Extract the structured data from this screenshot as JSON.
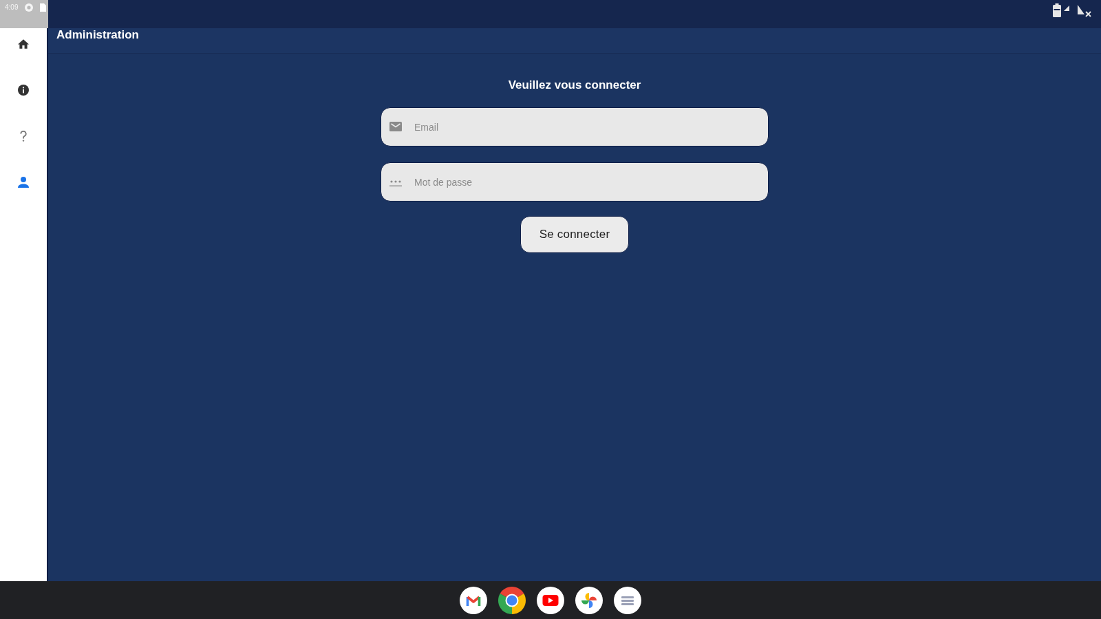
{
  "status_bar": {
    "time": "4:09"
  },
  "sidebar": {
    "items": [
      {
        "kind": "home",
        "selected": false
      },
      {
        "kind": "info",
        "selected": false
      },
      {
        "kind": "help",
        "selected": false
      },
      {
        "kind": "account",
        "selected": true
      }
    ]
  },
  "header": {
    "title": "Administration"
  },
  "login": {
    "title": "Veuillez vous connecter",
    "fields": [
      {
        "kind": "email",
        "placeholder": "Email"
      },
      {
        "kind": "password",
        "placeholder": "Mot de passe"
      }
    ],
    "submit": "Se connecter"
  },
  "dock": {
    "apps": [
      {
        "kind": "mail"
      },
      {
        "kind": "browser"
      },
      {
        "kind": "video"
      },
      {
        "kind": "photos"
      },
      {
        "kind": "lines"
      }
    ]
  }
}
